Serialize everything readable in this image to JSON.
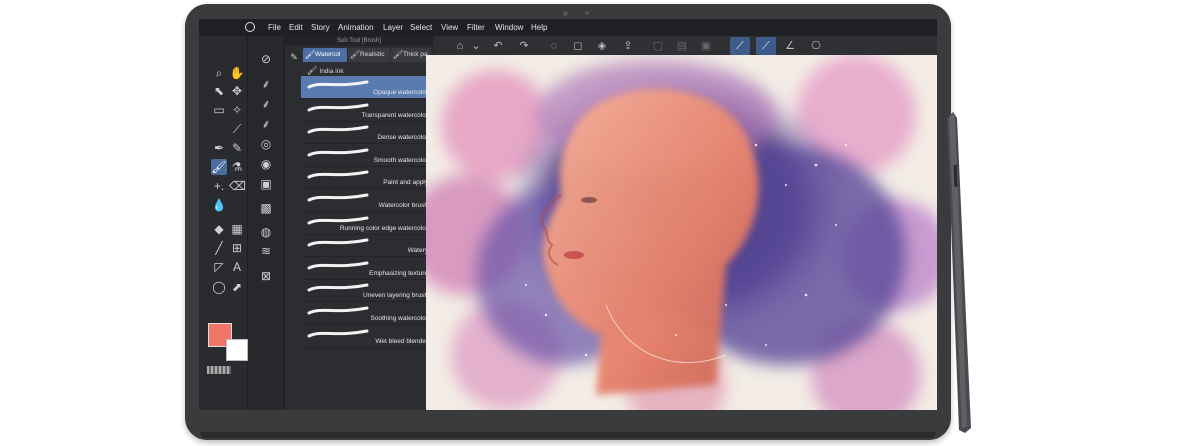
{
  "menu": [
    "File",
    "Edit",
    "Story",
    "Animation",
    "Layer",
    "Select",
    "View",
    "Filter",
    "Window",
    "Help"
  ],
  "panel_title": "Sub Tool [Brush]",
  "tabs": [
    {
      "label": "Watercol",
      "icon": "brush-icon",
      "active": true
    },
    {
      "label": "Realistic",
      "icon": "brush-icon",
      "active": false
    },
    {
      "label": "Thick pa",
      "icon": "brush-icon",
      "active": false
    }
  ],
  "india_ink": "India ink",
  "brushes": [
    {
      "label": "Opaque watercolor",
      "selected": true
    },
    {
      "label": "Transparent watercolor",
      "selected": false
    },
    {
      "label": "Dense watercolor",
      "selected": false
    },
    {
      "label": "Smooth watercolor",
      "selected": false
    },
    {
      "label": "Paint and apply",
      "selected": false
    },
    {
      "label": "Watercolor brush",
      "selected": false
    },
    {
      "label": "Running color edge watercolor",
      "selected": false
    },
    {
      "label": "Watery",
      "selected": false
    },
    {
      "label": "Emphasizing texture",
      "selected": false
    },
    {
      "label": "Uneven layering brush",
      "selected": false
    },
    {
      "label": "Soothing watercolor",
      "selected": false
    },
    {
      "label": "Wet bleed blender",
      "selected": false
    }
  ],
  "colors": {
    "main": "#f0766a",
    "sub": "#ffffff",
    "accent": "#4b6fa3"
  }
}
